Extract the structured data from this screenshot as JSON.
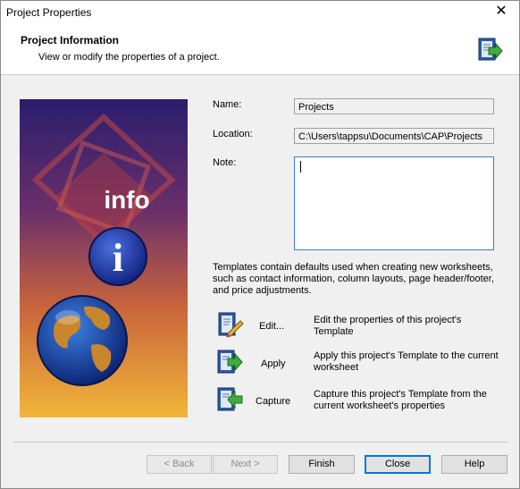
{
  "window": {
    "title": "Project Properties"
  },
  "header": {
    "title": "Project Information",
    "subtitle": "View or modify the properties of a project."
  },
  "art": {
    "info_text": "info",
    "i_text": "i"
  },
  "form": {
    "name_label": "Name:",
    "name_value": "Projects",
    "location_label": "Location:",
    "location_value": "C:\\Users\\tappsu\\Documents\\CAP\\Projects",
    "note_label": "Note:",
    "note_value": ""
  },
  "templates_description": "Templates contain defaults used when creating new worksheets, such as contact information, column layouts, page header/footer, and price adjustments.",
  "actions": [
    {
      "label": "Edit...",
      "description": "Edit the properties of this project's Template",
      "icon": "edit-template-icon"
    },
    {
      "label": "Apply",
      "description": "Apply this project's Template to the current worksheet",
      "icon": "apply-template-icon"
    },
    {
      "label": "Capture",
      "description": "Capture this project's Template from the current worksheet's properties",
      "icon": "capture-template-icon"
    }
  ],
  "buttons": {
    "back": "< Back",
    "next": "Next >",
    "finish": "Finish",
    "close": "Close",
    "help": "Help"
  }
}
